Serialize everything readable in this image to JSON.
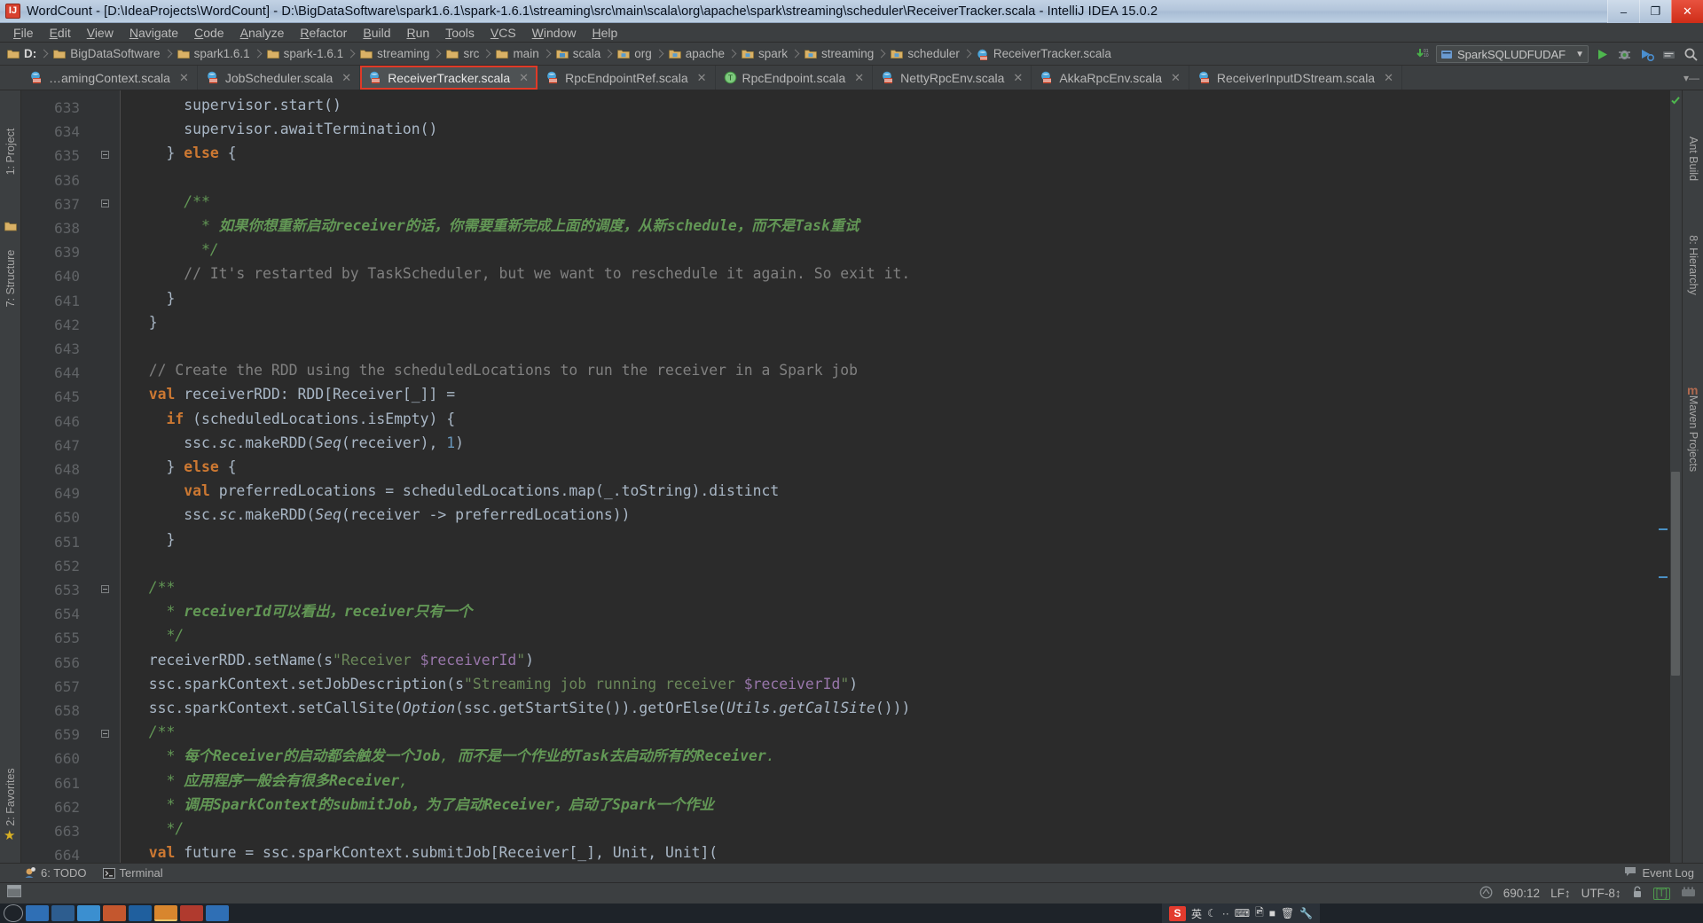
{
  "window": {
    "title": "WordCount - [D:\\IdeaProjects\\WordCount] - D:\\BigDataSoftware\\spark1.6.1\\spark-1.6.1\\streaming\\src\\main\\scala\\org\\apache\\spark\\streaming\\scheduler\\ReceiverTracker.scala - IntelliJ IDEA 15.0.2",
    "app_icon_label": "IJ",
    "buttons": {
      "minimize": "–",
      "maximize": "❐",
      "close": "✕"
    }
  },
  "menubar": {
    "items": [
      "File",
      "Edit",
      "View",
      "Navigate",
      "Code",
      "Analyze",
      "Refactor",
      "Build",
      "Run",
      "Tools",
      "VCS",
      "Window",
      "Help"
    ]
  },
  "navbar": {
    "crumbs": [
      {
        "label": "D:",
        "icon": "folder-icon",
        "bold": true
      },
      {
        "label": "BigDataSoftware",
        "icon": "folder-icon",
        "bold": false
      },
      {
        "label": "spark1.6.1",
        "icon": "folder-icon",
        "bold": false
      },
      {
        "label": "spark-1.6.1",
        "icon": "folder-icon",
        "bold": false
      },
      {
        "label": "streaming",
        "icon": "folder-icon",
        "bold": false
      },
      {
        "label": "src",
        "icon": "folder-icon",
        "bold": false
      },
      {
        "label": "main",
        "icon": "folder-icon",
        "bold": false
      },
      {
        "label": "scala",
        "icon": "source-folder-icon",
        "bold": false
      },
      {
        "label": "org",
        "icon": "package-icon",
        "bold": false
      },
      {
        "label": "apache",
        "icon": "package-icon",
        "bold": false
      },
      {
        "label": "spark",
        "icon": "package-icon",
        "bold": false
      },
      {
        "label": "streaming",
        "icon": "package-icon",
        "bold": false
      },
      {
        "label": "scheduler",
        "icon": "package-icon",
        "bold": false
      },
      {
        "label": "ReceiverTracker.scala",
        "icon": "scala-file-icon",
        "bold": false
      }
    ],
    "run_config": "SparkSQLUDFUDAF",
    "toolbar_icons": [
      "update-project-icon",
      "run-icon",
      "debug-icon",
      "coverage-icon",
      "build-icon",
      "search-everywhere-icon"
    ]
  },
  "tabs": [
    {
      "label": "…amingContext.scala",
      "icon": "scala-class-icon",
      "active": false,
      "highlight": false
    },
    {
      "label": "JobScheduler.scala",
      "icon": "scala-class-icon",
      "active": false,
      "highlight": false
    },
    {
      "label": "ReceiverTracker.scala",
      "icon": "scala-class-icon",
      "active": true,
      "highlight": true
    },
    {
      "label": "RpcEndpointRef.scala",
      "icon": "scala-class-icon",
      "active": false,
      "highlight": false
    },
    {
      "label": "RpcEndpoint.scala",
      "icon": "scala-trait-icon",
      "active": false,
      "highlight": false
    },
    {
      "label": "NettyRpcEnv.scala",
      "icon": "scala-class-icon",
      "active": false,
      "highlight": false
    },
    {
      "label": "AkkaRpcEnv.scala",
      "icon": "scala-class-icon",
      "active": false,
      "highlight": false
    },
    {
      "label": "ReceiverInputDStream.scala",
      "icon": "scala-class-icon",
      "active": false,
      "highlight": false
    }
  ],
  "left_tool_tabs": [
    "1: Project",
    "7: Structure",
    "2: Favorites"
  ],
  "right_tool_tabs": [
    "Ant Build",
    "8: Hierarchy",
    "Maven Projects"
  ],
  "editor": {
    "first_line": 633,
    "lines": [
      {
        "n": 633,
        "fold": false,
        "text": "      supervisor.start()"
      },
      {
        "n": 634,
        "fold": false,
        "text": "      supervisor.awaitTermination()"
      },
      {
        "n": 635,
        "fold": true,
        "text": "    } else {"
      },
      {
        "n": 636,
        "fold": false,
        "text": ""
      },
      {
        "n": 637,
        "fold": true,
        "text": "      /**"
      },
      {
        "n": 638,
        "fold": false,
        "text": "        * 如果你想重新启动receiver的话，你需要重新完成上面的调度，从新schedule，而不是Task重试"
      },
      {
        "n": 639,
        "fold": false,
        "text": "        */"
      },
      {
        "n": 640,
        "fold": false,
        "text": "      // It's restarted by TaskScheduler, but we want to reschedule it again. So exit it."
      },
      {
        "n": 641,
        "fold": false,
        "text": "    }"
      },
      {
        "n": 642,
        "fold": false,
        "text": "  }"
      },
      {
        "n": 643,
        "fold": false,
        "text": ""
      },
      {
        "n": 644,
        "fold": false,
        "text": "  // Create the RDD using the scheduledLocations to run the receiver in a Spark job"
      },
      {
        "n": 645,
        "fold": false,
        "text": "  val receiverRDD: RDD[Receiver[_]] ="
      },
      {
        "n": 646,
        "fold": false,
        "text": "    if (scheduledLocations.isEmpty) {"
      },
      {
        "n": 647,
        "fold": false,
        "text": "      ssc.sc.makeRDD(Seq(receiver), 1)"
      },
      {
        "n": 648,
        "fold": false,
        "text": "    } else {"
      },
      {
        "n": 649,
        "fold": false,
        "text": "      val preferredLocations = scheduledLocations.map(_.toString).distinct"
      },
      {
        "n": 650,
        "fold": false,
        "text": "      ssc.sc.makeRDD(Seq(receiver -> preferredLocations))"
      },
      {
        "n": 651,
        "fold": false,
        "text": "    }"
      },
      {
        "n": 652,
        "fold": false,
        "text": ""
      },
      {
        "n": 653,
        "fold": true,
        "text": "  /**"
      },
      {
        "n": 654,
        "fold": false,
        "text": "    * receiverId可以看出，receiver只有一个"
      },
      {
        "n": 655,
        "fold": false,
        "text": "    */"
      },
      {
        "n": 656,
        "fold": false,
        "text": "  receiverRDD.setName(s\"Receiver $receiverId\")"
      },
      {
        "n": 657,
        "fold": false,
        "text": "  ssc.sparkContext.setJobDescription(s\"Streaming job running receiver $receiverId\")"
      },
      {
        "n": 658,
        "fold": false,
        "text": "  ssc.sparkContext.setCallSite(Option(ssc.getStartSite()).getOrElse(Utils.getCallSite()))"
      },
      {
        "n": 659,
        "fold": true,
        "text": "  /**"
      },
      {
        "n": 660,
        "fold": false,
        "text": "    * 每个Receiver的启动都会触发一个Job, 而不是一个作业的Task去启动所有的Receiver."
      },
      {
        "n": 661,
        "fold": false,
        "text": "    * 应用程序一般会有很多Receiver,"
      },
      {
        "n": 662,
        "fold": false,
        "text": "    * 调用SparkContext的submitJob，为了启动Receiver，启动了Spark一个作业"
      },
      {
        "n": 663,
        "fold": false,
        "text": "    */"
      },
      {
        "n": 664,
        "fold": false,
        "text": "  val future = ssc.sparkContext.submitJob[Receiver[_], Unit, Unit]("
      }
    ]
  },
  "bottom_tool_window": {
    "items": [
      {
        "label": "6: TODO",
        "icon": "todo-icon"
      },
      {
        "label": "Terminal",
        "icon": "terminal-icon"
      }
    ],
    "right_label": "Event Log",
    "right_icon": "event-log-icon"
  },
  "statusbar": {
    "caret_position": "690:12",
    "line_separator": "LF",
    "encoding": "UTF-8",
    "lock_icon": "unlocked-icon",
    "indent_badge": "[T]",
    "hector_icon": "inspection-hector-icon",
    "memory_icon": "memory-indicator-icon"
  },
  "taskbar": {
    "tray_ime_label": "英",
    "sogou_label": "S",
    "tray_icons": [
      "sogou-icon",
      "ime-chinese-icon",
      "moon-icon",
      "dot-icon",
      "keyboard-icon",
      "image-icon",
      "box-icon",
      "trash-icon",
      "wrench-icon"
    ]
  },
  "colors": {
    "accent_red": "#e03a27",
    "editor_bg": "#2b2b2b",
    "chrome_bg": "#3c3f41",
    "gutter_bg": "#313335",
    "keyword": "#cc7832",
    "string": "#6a8759",
    "number": "#6897bb",
    "comment": "#808080",
    "doc_comment": "#629755",
    "field": "#9876aa",
    "default_text": "#a9b7c6"
  }
}
